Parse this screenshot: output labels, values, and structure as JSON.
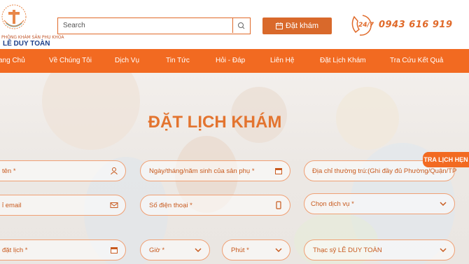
{
  "header": {
    "logo_top_text": "PHÒNG KHÁM SẢN PHỤ KHOA",
    "logo_name": "LÊ DUY TOÀN",
    "search_placeholder": "Search",
    "book_button": "Đặt khám",
    "hotline": "0943 616 919"
  },
  "nav": {
    "items": [
      "ang Chủ",
      "Về Chúng Tôi",
      "Dịch Vụ",
      "Tin Tức",
      "Hỏi - Đáp",
      "Liên Hệ",
      "Đặt Lịch Khám",
      "Tra Cứu Kết Quả"
    ]
  },
  "form": {
    "title": "ĐẶT LỊCH KHÁM",
    "name_label": "tên *",
    "dob_label": "Ngày/tháng/năm sinh của sản phụ *",
    "address_label": "Địa chỉ thường trú:(Ghi đầy đủ Phường/Quận/TP",
    "email_label": "ỉ email",
    "phone_label": "Số điện thoại *",
    "service_label": "Chọn dịch vụ *",
    "date_label": "đặt lịch *",
    "hour_label": "Giờ *",
    "minute_label": "Phút *",
    "doctor_label": "Thạc sỹ LÊ DUY TOÀN"
  },
  "side_tab": {
    "label": "TRA LỊCH HẸN"
  },
  "colors": {
    "accent": "#f26a21",
    "brand_blue": "#1e3f8a"
  }
}
